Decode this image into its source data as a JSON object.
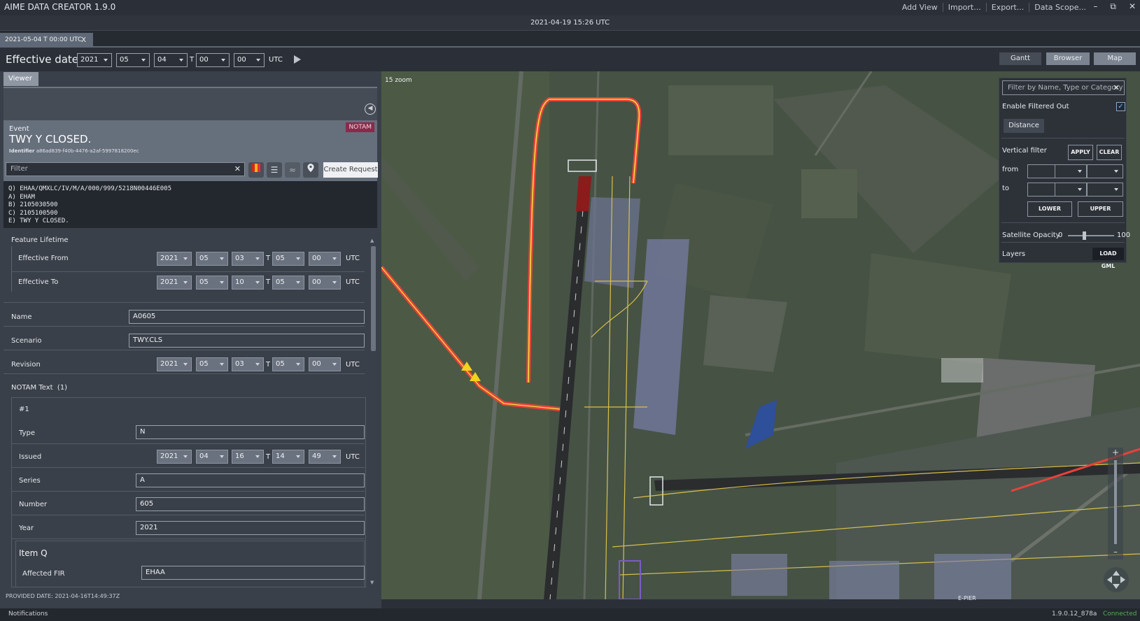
{
  "app": {
    "title": "AIME DATA CREATOR 1.9.0"
  },
  "menu": {
    "add_view": "Add View",
    "import": "Import...",
    "export": "Export...",
    "data_scope": "Data Scope..."
  },
  "window_controls": {
    "minimize": "–",
    "restore": "⧉",
    "close": "✕"
  },
  "current_datetime": "2021-04-19 15:26 UTC",
  "doc_tab": {
    "label": "2021-05-04 T 00:00 UTC",
    "close": "X"
  },
  "effective": {
    "label": "Effective date",
    "year": "2021",
    "month": "05",
    "day": "04",
    "t": "T",
    "hour": "00",
    "minute": "00",
    "utc": "UTC"
  },
  "views": {
    "gantt": "Gantt",
    "browser": "Browser",
    "map": "Map",
    "active": "Map"
  },
  "viewer_tab": "Viewer",
  "event": {
    "label": "Event",
    "title": "TWY Y CLOSED.",
    "badge": "NOTAM",
    "identifier_label": "Identifier",
    "identifier": "a86ad839-f40b-4476-a2af-5997818200ec"
  },
  "filter": {
    "placeholder": "Filter",
    "clear": "✕"
  },
  "create_request": "Create Request",
  "notam_text": "Q) EHAA/QMXLC/IV/M/A/000/999/5218N00446E005\nA) EHAM\nB) 2105030500\nC) 2105100500\nE) TWY Y CLOSED.",
  "form": {
    "feature_lifetime": "Feature Lifetime",
    "effective_from": {
      "label": "Effective From",
      "year": "2021",
      "month": "05",
      "day": "03",
      "hour": "05",
      "minute": "00"
    },
    "effective_to": {
      "label": "Effective To",
      "year": "2021",
      "month": "05",
      "day": "10",
      "hour": "05",
      "minute": "00"
    },
    "name": {
      "label": "Name",
      "value": "A0605"
    },
    "scenario": {
      "label": "Scenario",
      "value": "TWY.CLS"
    },
    "revision": {
      "label": "Revision",
      "year": "2021",
      "month": "05",
      "day": "03",
      "hour": "05",
      "minute": "00"
    },
    "notam_text_section": "NOTAM Text",
    "notam_text_count": "(1)",
    "entry_no": "#1",
    "type": {
      "label": "Type",
      "value": "N"
    },
    "issued": {
      "label": "Issued",
      "year": "2021",
      "month": "04",
      "day": "16",
      "hour": "14",
      "minute": "49"
    },
    "series": {
      "label": "Series",
      "value": "A"
    },
    "number": {
      "label": "Number",
      "value": "605"
    },
    "year": {
      "label": "Year",
      "value": "2021"
    },
    "item_q": "Item Q",
    "affected_fir": {
      "label": "Affected FIR",
      "value": "EHAA"
    },
    "t": "T",
    "utc": "UTC"
  },
  "provided_date": "PROVIDED DATE: 2021-04-16T14:49:37Z",
  "map": {
    "zoom_label": "15 zoom",
    "pier_label": "E-PIER",
    "colors": {
      "closed": "#e8423a",
      "edge": "#f2e640",
      "taxiway": "#e6c84a",
      "apron": "#7e84a8"
    }
  },
  "map_controls": {
    "filter_placeholder": "Filter by Name, Type or Category",
    "clear": "✕",
    "enable_filtered_out": "Enable Filtered Out",
    "enable_filtered_out_checked": true,
    "check_mark": "✓",
    "distance": "Distance",
    "vertical_filter": "Vertical filter",
    "apply": "APPLY",
    "clear_btn": "CLEAR",
    "from": "from",
    "to": "to",
    "lower": "LOWER",
    "upper": "UPPER",
    "satellite_opacity": "Satellite Opacity",
    "opacity_min": "0",
    "opacity_max": "100",
    "opacity_value": 35,
    "layers": "Layers",
    "load_gml": "LOAD GML",
    "zoom_in": "+",
    "zoom_out": "–"
  },
  "status": {
    "notifications": "Notifications",
    "version": "1.9.0.12_878a",
    "connection": "Connected"
  }
}
